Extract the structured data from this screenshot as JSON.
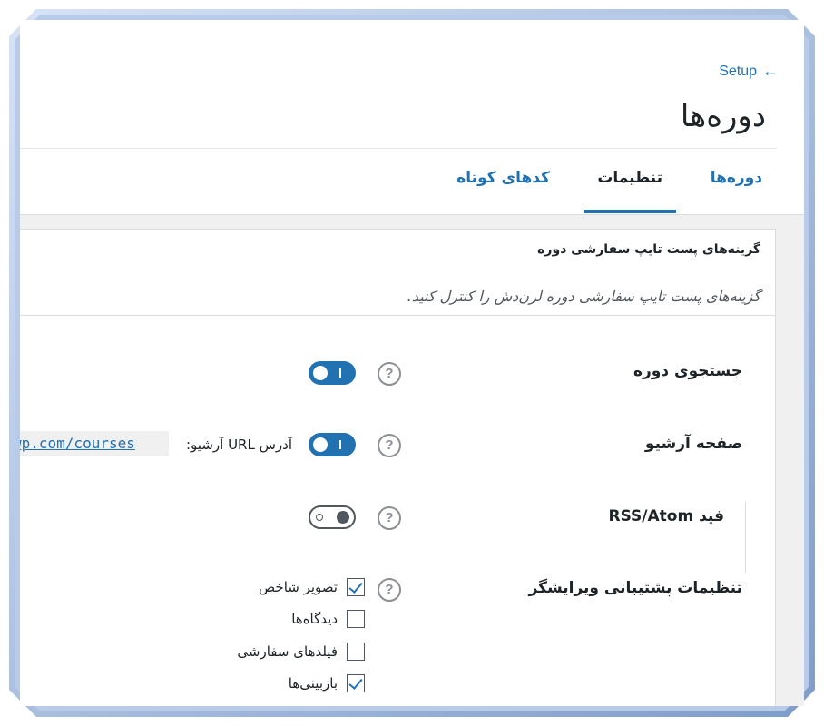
{
  "header": {
    "back_label": "Setup",
    "back_arrow": "←",
    "title": "دوره‌ها"
  },
  "tabs": [
    {
      "label": "دوره‌ها",
      "active": false
    },
    {
      "label": "تنظیمات",
      "active": true
    },
    {
      "label": "کدهای کوتاه",
      "active": false
    }
  ],
  "section": {
    "title": "گزینه‌های پست تایپ سفارشی دوره",
    "description": "گزینه‌های پست تایپ سفارشی دوره لرن‌دش را کنترل کنید."
  },
  "rows": {
    "search": {
      "label": "جستجوی دوره",
      "help": "?",
      "enabled": true
    },
    "archive": {
      "label": "صفحه آرشیو",
      "help": "?",
      "enabled": true,
      "url_label": "آدرس URL آرشیو:",
      "url_value": "wp.com/courses"
    },
    "rss": {
      "label": "فید RSS/Atom",
      "help": "?",
      "enabled": false
    },
    "editor": {
      "label": "تنظیمات پشتیبانی ویرایشگر",
      "help": "?",
      "options": [
        {
          "label": "تصویر شاخص",
          "checked": true
        },
        {
          "label": "دیدگاه‌ها",
          "checked": false
        },
        {
          "label": "فیلدهای سفارشی",
          "checked": false
        },
        {
          "label": "بازبینی‌ها",
          "checked": true
        }
      ]
    }
  },
  "colors": {
    "accent": "#2271b1",
    "frame": "#a9bfe3"
  }
}
